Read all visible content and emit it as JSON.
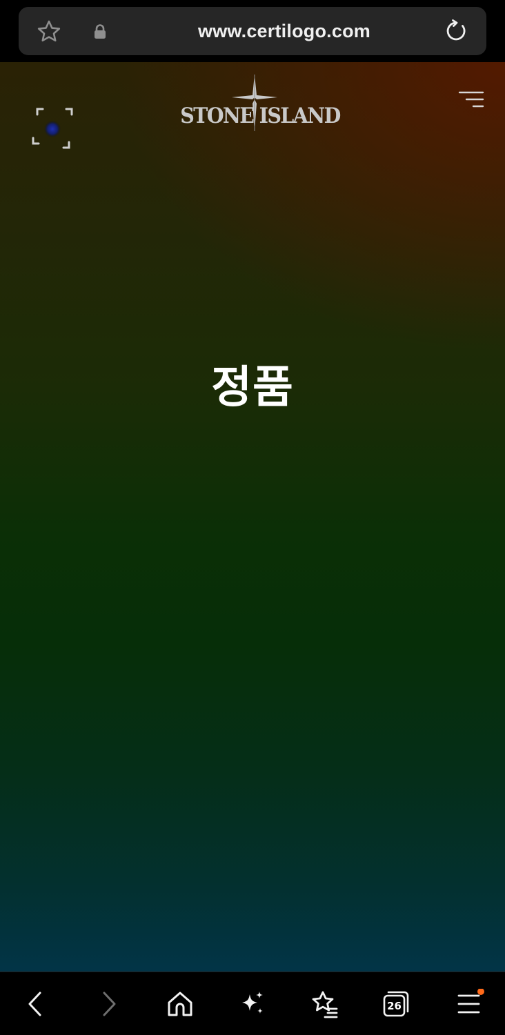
{
  "browser": {
    "url": "www.certilogo.com",
    "icons": {
      "bookmark": "star-outline-icon",
      "secure": "lock-icon",
      "reload": "reload-icon"
    }
  },
  "header": {
    "brand": "STONE ISLAND",
    "scan_icon": "scan-frame-icon",
    "menu_icon": "hamburger-menu-icon"
  },
  "result": {
    "status": "정품"
  },
  "toolbar": {
    "items": [
      {
        "name": "back",
        "icon": "chevron-left-icon"
      },
      {
        "name": "forward",
        "icon": "chevron-right-icon"
      },
      {
        "name": "home",
        "icon": "home-icon"
      },
      {
        "name": "ai-assist",
        "icon": "sparkle-icon"
      },
      {
        "name": "bookmarks",
        "icon": "star-list-icon"
      },
      {
        "name": "tabs",
        "icon": "tabs-icon"
      },
      {
        "name": "menu",
        "icon": "hamburger-icon"
      }
    ],
    "tab_count": "26"
  },
  "colors": {
    "accent_dot": "#ff6a1a",
    "text": "#ffffff",
    "logo": "#c9c9c9"
  }
}
